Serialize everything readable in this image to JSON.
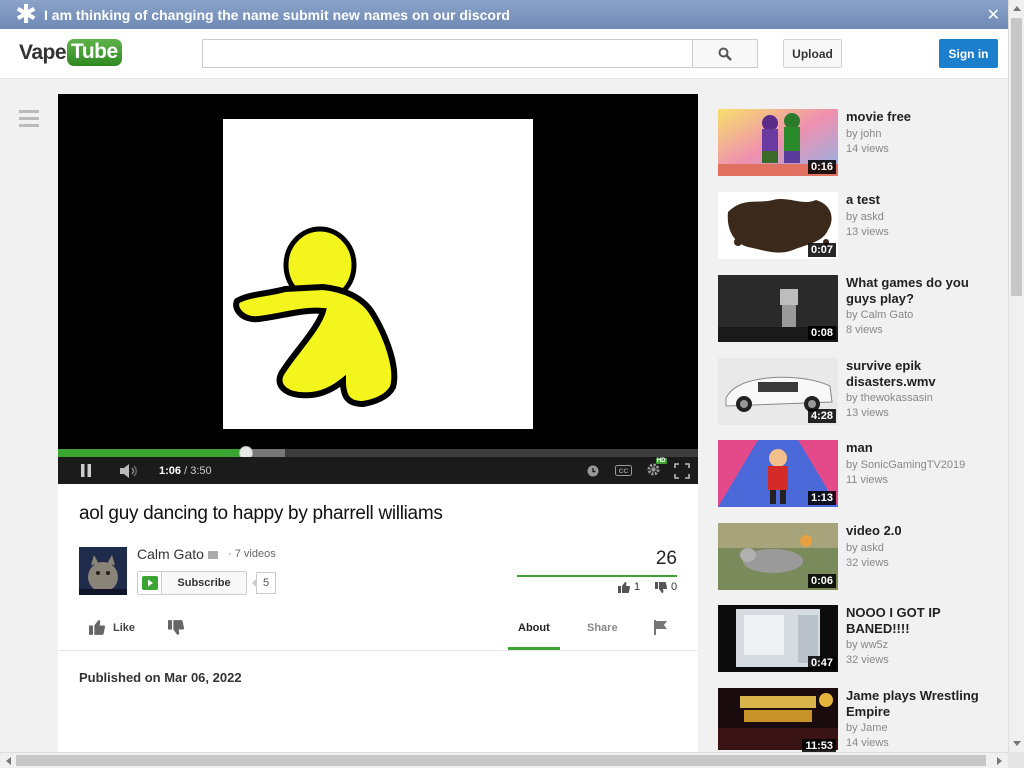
{
  "banner": {
    "message": "I am thinking of changing the name submit new names on our discord",
    "close_glyph": "✕"
  },
  "header": {
    "logo_left": "Vape",
    "logo_right": "Tube",
    "search_value": "",
    "upload_label": "Upload",
    "signin_label": "Sign in"
  },
  "player": {
    "current_time": "1:06",
    "duration": "/ 3:50",
    "played_fraction": 0.293,
    "buffered_fraction": 0.355,
    "hd_label": "HD"
  },
  "video": {
    "title": "aol guy dancing to happy by pharrell williams",
    "channel_name": "Calm Gato",
    "video_count": "· 7 videos",
    "subscribe_label": "Subscribe",
    "subscriber_count": "5",
    "view_count": "26",
    "likes": "1",
    "dislikes": "0",
    "like_fraction": 1.0,
    "like_label": "Like",
    "published": "Published on Mar 06, 2022"
  },
  "tabs": [
    {
      "label": "About",
      "active": true
    },
    {
      "label": "Share",
      "active": false
    }
  ],
  "recommendations": [
    {
      "title": "movie free",
      "channel": "by john",
      "views": "14 views",
      "duration": "0:16"
    },
    {
      "title": "a test",
      "channel": "by askd",
      "views": "13 views",
      "duration": "0:07"
    },
    {
      "title": "What games do you guys play?",
      "channel": "by Calm Gato",
      "views": "8 views",
      "duration": "0:08"
    },
    {
      "title": "survive epik disasters.wmv",
      "channel": "by thewokassasin",
      "views": "13 views",
      "duration": "4:28"
    },
    {
      "title": "man",
      "channel": "by SonicGamingTV2019",
      "views": "11 views",
      "duration": "1:13"
    },
    {
      "title": "video 2.0",
      "channel": "by askd",
      "views": "32 views",
      "duration": "0:06"
    },
    {
      "title": "NOOO I GOT IP BANED!!!!",
      "channel": "by ww5z",
      "views": "32 views",
      "duration": "0:47"
    },
    {
      "title": "Jame plays Wrestling Empire",
      "channel": "by Jame",
      "views": "14 views",
      "duration": "11:53"
    }
  ],
  "colors": {
    "accent_green": "#3aa531",
    "signin_blue": "#1b7fcc",
    "banner_blue": "#7b95be"
  },
  "icons": [
    "asterisk-icon",
    "close-icon",
    "search-icon",
    "menu-icon",
    "pause-icon",
    "volume-icon",
    "clock-icon",
    "captions-icon",
    "gear-icon",
    "fullscreen-icon",
    "play-icon",
    "thumbs-up-icon",
    "thumbs-down-icon",
    "flag-icon"
  ]
}
